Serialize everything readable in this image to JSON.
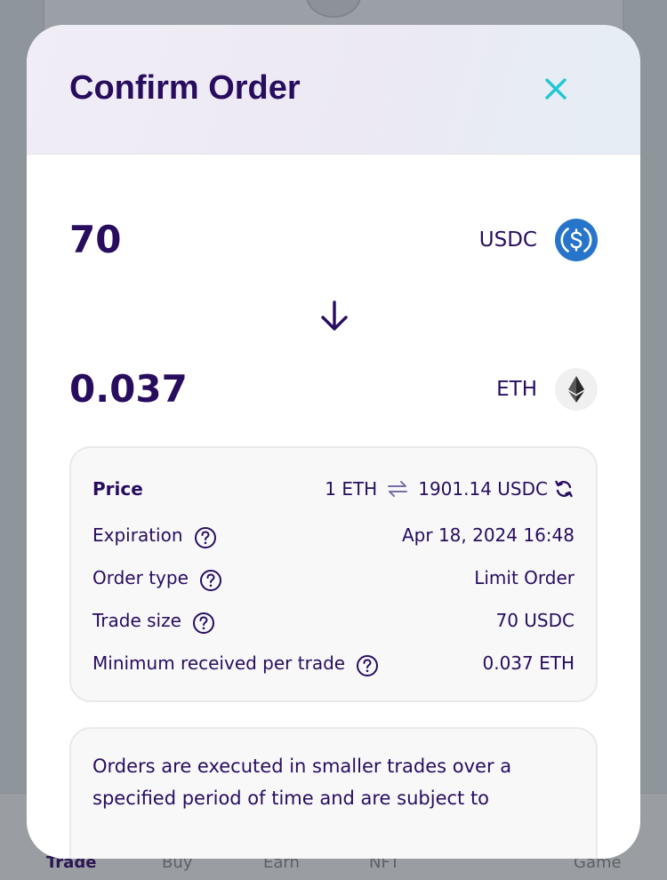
{
  "background": {
    "nav_items": [
      "Trade",
      "Buy",
      "Earn",
      "NFT",
      "Game"
    ]
  },
  "modal": {
    "title": "Confirm Order",
    "from": {
      "amount": "70",
      "token": "USDC",
      "icon": "usdc-icon"
    },
    "to": {
      "amount": "0.037",
      "token": "ETH",
      "icon": "eth-icon"
    },
    "details": {
      "price_label": "Price",
      "price_left": "1 ETH",
      "price_right": "1901.14 USDC",
      "expiration_label": "Expiration",
      "expiration_value": "Apr 18, 2024 16:48",
      "order_type_label": "Order type",
      "order_type_value": "Limit Order",
      "trade_size_label": "Trade size",
      "trade_size_value": "70 USDC",
      "min_received_label": "Minimum received per trade",
      "min_received_value": "0.037 ETH"
    },
    "note": "Orders are executed in smaller trades over a specified period of time and are subject to"
  },
  "colors": {
    "primary_text": "#280d5f",
    "accent": "#1fc7d4",
    "usdc_blue": "#2775ca"
  }
}
